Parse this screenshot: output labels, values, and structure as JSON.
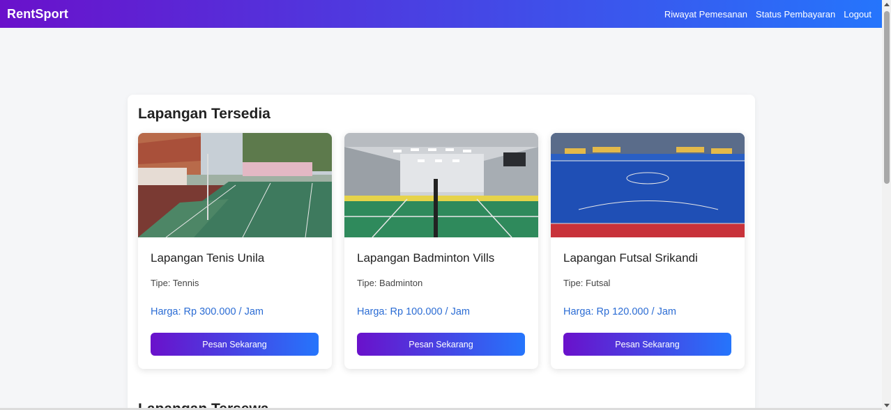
{
  "brand": "RentSport",
  "nav": {
    "history": "Riwayat Pemesanan",
    "payment_status": "Status Pembayaran",
    "logout": "Logout"
  },
  "section": {
    "title": "Lapangan Tersedia",
    "next_title": "Lapangan Tersewa"
  },
  "fields": [
    {
      "name": "Lapangan Tenis Unila",
      "type": "Tipe: Tennis",
      "price": "Harga: Rp 300.000 / Jam",
      "button": "Pesan Sekarang"
    },
    {
      "name": "Lapangan Badminton Vills",
      "type": "Tipe: Badminton",
      "price": "Harga: Rp 100.000 / Jam",
      "button": "Pesan Sekarang"
    },
    {
      "name": "Lapangan Futsal Srikandi",
      "type": "Tipe: Futsal",
      "price": "Harga: Rp 120.000 / Jam",
      "button": "Pesan Sekarang"
    }
  ],
  "colors": {
    "gradient_start": "#6a11cb",
    "gradient_end": "#2575fc",
    "price": "#2b6cd4"
  }
}
